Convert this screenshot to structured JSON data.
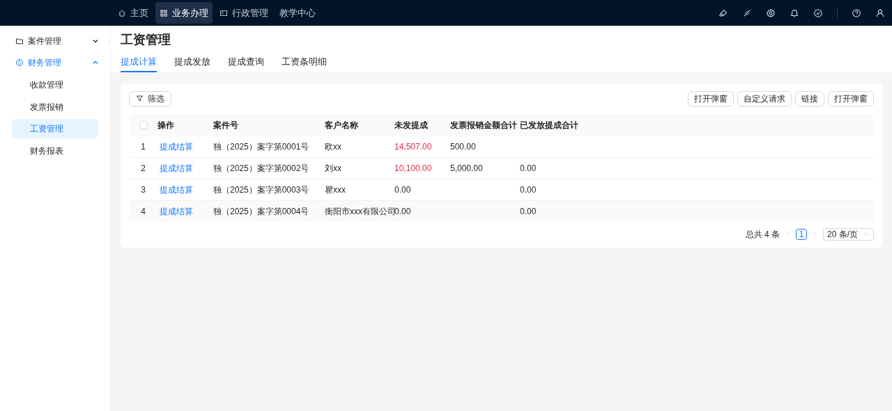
{
  "top_nav": {
    "items": [
      {
        "label": "主页",
        "selected": false
      },
      {
        "label": "业务办理",
        "selected": true
      },
      {
        "label": "行政管理",
        "selected": false
      },
      {
        "label": "教学中心",
        "selected": false
      }
    ]
  },
  "sidebar": {
    "items": [
      {
        "label": "案件管理",
        "expanded": false
      },
      {
        "label": "财务管理",
        "expanded": true,
        "children": [
          {
            "label": "收款管理",
            "selected": false
          },
          {
            "label": "发票报销",
            "selected": false
          },
          {
            "label": "工资管理",
            "selected": true
          },
          {
            "label": "财务报表",
            "selected": false
          }
        ]
      }
    ]
  },
  "page": {
    "title": "工资管理",
    "tabs": [
      {
        "label": "提成计算",
        "selected": true
      },
      {
        "label": "提成发放",
        "selected": false
      },
      {
        "label": "提成查询",
        "selected": false
      },
      {
        "label": "工资条明细",
        "selected": false
      }
    ]
  },
  "toolbar": {
    "filter_button": "筛选",
    "action_buttons": [
      "打开弹窗",
      "自定义请求",
      "链接",
      "打开弹窗"
    ]
  },
  "table": {
    "select_all": {
      "checked": false
    },
    "columns": [
      "操作",
      "案件号",
      "客户名称",
      "未发提成",
      "发票报销金额合计",
      "已发放提成合计"
    ],
    "rows": [
      {
        "index": "1",
        "action": "提成结算",
        "case_no": "独（2025）案字第0001号",
        "client": "欧xx",
        "unpaid": "14,507.00",
        "unpaid_alert": true,
        "invoice_total": "500.00"
      },
      {
        "index": "2",
        "action": "提成结算",
        "case_no": "独（2025）案字第0002号",
        "client": "刘xx",
        "unpaid": "10,100.00",
        "unpaid_alert": true,
        "invoice_total": "5,000.00",
        "paid_total": "0.00"
      },
      {
        "index": "3",
        "action": "提成结算",
        "case_no": "独（2025）案字第0003号",
        "client": "瞿xxx",
        "unpaid": "0.00",
        "unpaid_alert": false,
        "paid_total": "0.00"
      },
      {
        "index": "4",
        "action": "提成结算",
        "case_no": "独（2025）案字第0004号",
        "client": "衡阳市xxx有限公司",
        "unpaid": "0.00",
        "unpaid_alert": false,
        "paid_total": "0.00"
      }
    ]
  },
  "pagination": {
    "total": "总共 4 条",
    "current_page": "1",
    "page_size": "20 条/页"
  }
}
